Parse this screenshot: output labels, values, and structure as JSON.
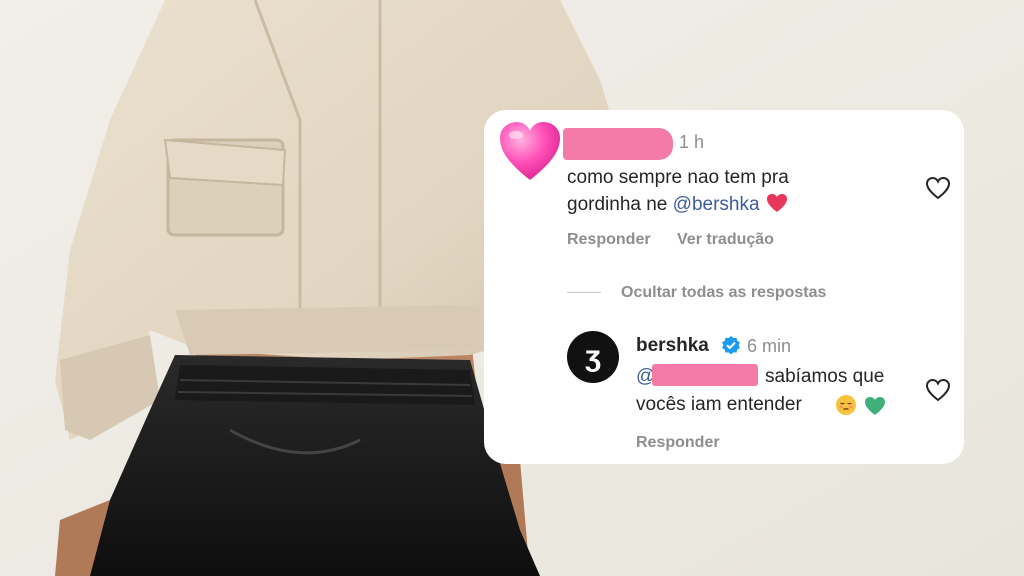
{
  "comment": {
    "time": "1 h",
    "text_line1": "como sempre nao tem pra",
    "text_line2_prefix": "gordinha ne ",
    "mention": "@bershka",
    "reply_action": "Responder",
    "translate_action": "Ver tradução"
  },
  "replies_toggle": {
    "label": "Ocultar todas as respostas"
  },
  "reply": {
    "username": "bershka",
    "time": "6 min",
    "mention_prefix": "@",
    "text_line1": "sabíamos que",
    "text_line2": "vocês iam entender",
    "reply_action": "Responder",
    "avatar_glyph": "ʒ"
  },
  "icons": {
    "avatar": "pink-heart-icon",
    "mini_heart": "red-heart-emoji-icon",
    "like": "heart-outline-icon",
    "verified": "verified-badge-icon",
    "face": "pensive-face-emoji-icon",
    "green_heart": "green-heart-emoji-icon"
  },
  "colors": {
    "redaction": "#f47aa8",
    "mention": "#3e5c9a",
    "verified": "#1d9bf0"
  }
}
